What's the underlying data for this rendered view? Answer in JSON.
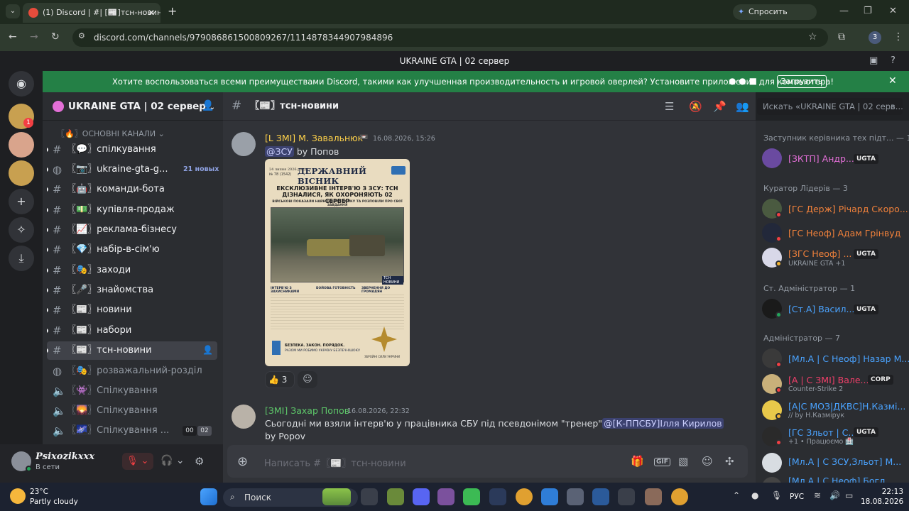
{
  "browser": {
    "tab_title": "(1) Discord | #| [📰]тсн-новини",
    "gemini_label": "Спросить Gemini",
    "url": "discord.com/channels/979086861500809267/1114878344907984896",
    "profile_count": "3"
  },
  "discord": {
    "window_title": "UKRAINE GTA | 02 сервер",
    "banner_text": "Хотите воспользоваться всеми преимуществами Discord, такими как улучшенная производительность и игровой оверлей? Установите приложение для компьютера!",
    "banner_button": "Загрузить",
    "server_badge": "1"
  },
  "sidebar": {
    "server_name": "UKRAINE GTA | 02 сервер",
    "category": "〖🔥〗ОСНОВНІ КАНАЛИ",
    "channels": [
      {
        "label": "〖💬〗спілкування"
      },
      {
        "label": "〖📷〗ukraine-gta-g...",
        "new": "21 новых"
      },
      {
        "label": "〖🤖〗команди-бота"
      },
      {
        "label": "〖💵〗купівля-продаж"
      },
      {
        "label": "〖📈〗реклама-бізнесу"
      },
      {
        "label": "〖💎〗набір-в-сім'ю"
      },
      {
        "label": "〖🎭〗заходи"
      },
      {
        "label": "〖🎤〗знайомства"
      },
      {
        "label": "〖📰〗новини"
      },
      {
        "label": "〖📰〗набори"
      },
      {
        "label": "〖📰〗тсн-новини"
      },
      {
        "label": "〖🎭〗розважальний-розділ"
      },
      {
        "label": "〖👾〗Спілкування"
      },
      {
        "label": "〖🌄〗Спілкування"
      },
      {
        "label": "〖🌌〗Спілкування ...",
        "counts": [
          "00",
          "02"
        ]
      }
    ]
  },
  "user": {
    "name": "Psixozikxxx",
    "status": "В сети"
  },
  "chat": {
    "channel": "〖📰〗тсн-новини",
    "search_placeholder": "Искать «UKRAINE GTA | 02 серв...",
    "input_placeholder": "Написать #〖📰〗тсн-новини",
    "messages": [
      {
        "author": "[L ЗМІ] М. Завальнюк",
        "time": "16.08.2026, 15:26",
        "mention": "@ЗСУ",
        "text": " by Попов",
        "reaction": "👍",
        "reaction_count": "3"
      },
      {
        "author": "[ЗМІ] Захар Попов",
        "time": "16.08.2026, 22:32",
        "text": "Сьогодні ми взяли інтерв'ю у працівника СБУ під псевдонімом \"тренер\"",
        "mention": "@[К-ППСБУ]Ілля Кирилов",
        "text2": "by Popov"
      }
    ]
  },
  "poster": {
    "date": "24 липня 2026 року",
    "issue": "№ 78 (1542)",
    "title": "ДЕРЖАВНИЙ ВІСНИК",
    "headline": "ЕКСКЛЮЗИВНЕ ІНТЕРВ'Ю З ЗСУ: ТСН ДІЗНАЛИСЯ, ЯК ОХОРОНЯЮТЬ 02 СЕРВЕР",
    "subhead": "ВІЙСЬКОВІ ПОКАЗАЛИ НАЙНОВІШУ ТЕХНІКУ ТА РОЗПОВІЛИ ПРО СВОЇ ЗАВДАННЯ",
    "tsn": "ТСН НОВИНИ",
    "col1": "ІНТЕРВ'Ю З ЗАХИСНИКАМИ",
    "col2": "БОЙОВА ГОТОВНІСТЬ",
    "col3": "ЗВЕРНЕННЯ ДО ГРОМАДЯН",
    "slogan1": "БЕЗПЕКА. ЗАКОН. ПОРЯДОК.",
    "slogan2": "РАЗОМ МИ РОБИМО УКРАЇНУ БЕЗПЕЧНІШОЮ!",
    "footer": "ЗБРОЙНІ СИЛИ УКРАЇНИ"
  },
  "members": {
    "groups": [
      {
        "title": "Заступник керівника тех підт... — 1"
      },
      {
        "title": "Куратор Лідерів — 3"
      },
      {
        "title": "Ст. Адміністратор — 1"
      },
      {
        "title": "Адміністратор — 7"
      }
    ],
    "list": [
      {
        "name": "[ЗКТП] Андр...",
        "tag": "UGTA",
        "color": "#e36fd7"
      },
      {
        "name": "[ГС Держ] Річард Скоро...",
        "color": "#f0813b"
      },
      {
        "name": "[ГС Неоф] Адам Грінвуд",
        "color": "#f0813b"
      },
      {
        "name": "[ЗГС Неоф] ...",
        "tag": "UGTA",
        "sub": "UKRAINE GTA +1",
        "color": "#f0813b"
      },
      {
        "name": "[Ст.А] Васил...",
        "tag": "UGTA",
        "color": "#4aa3ff"
      },
      {
        "name": "[Мл.А | С Неоф] Назар М...",
        "color": "#4aa3ff"
      },
      {
        "name": "[А | С ЗМІ] Вале...",
        "tag": "CORP",
        "sub": "Counter-Strike 2",
        "color": "#f23f6a"
      },
      {
        "name": "[А|С МОЗ|ДКВС]Н.Казмі...",
        "sub": "// by Н.Казмірук",
        "color": "#4aa3ff"
      },
      {
        "name": "[ГС Зльот | С...",
        "tag": "UGTA",
        "sub": "+1 • Працюємо 🏥",
        "color": "#4aa3ff"
      },
      {
        "name": "[Мл.А | С ЗСУ,Зльот] М...",
        "color": "#4aa3ff"
      },
      {
        "name": "[Мл.А | С Неоф] Богд...",
        "color": "#4aa3ff"
      }
    ]
  },
  "taskbar": {
    "temp": "23°C",
    "weather": "Partly cloudy",
    "search": "Поиск",
    "lang": "РУС",
    "time": "22:13",
    "date": "18.08.2026"
  }
}
